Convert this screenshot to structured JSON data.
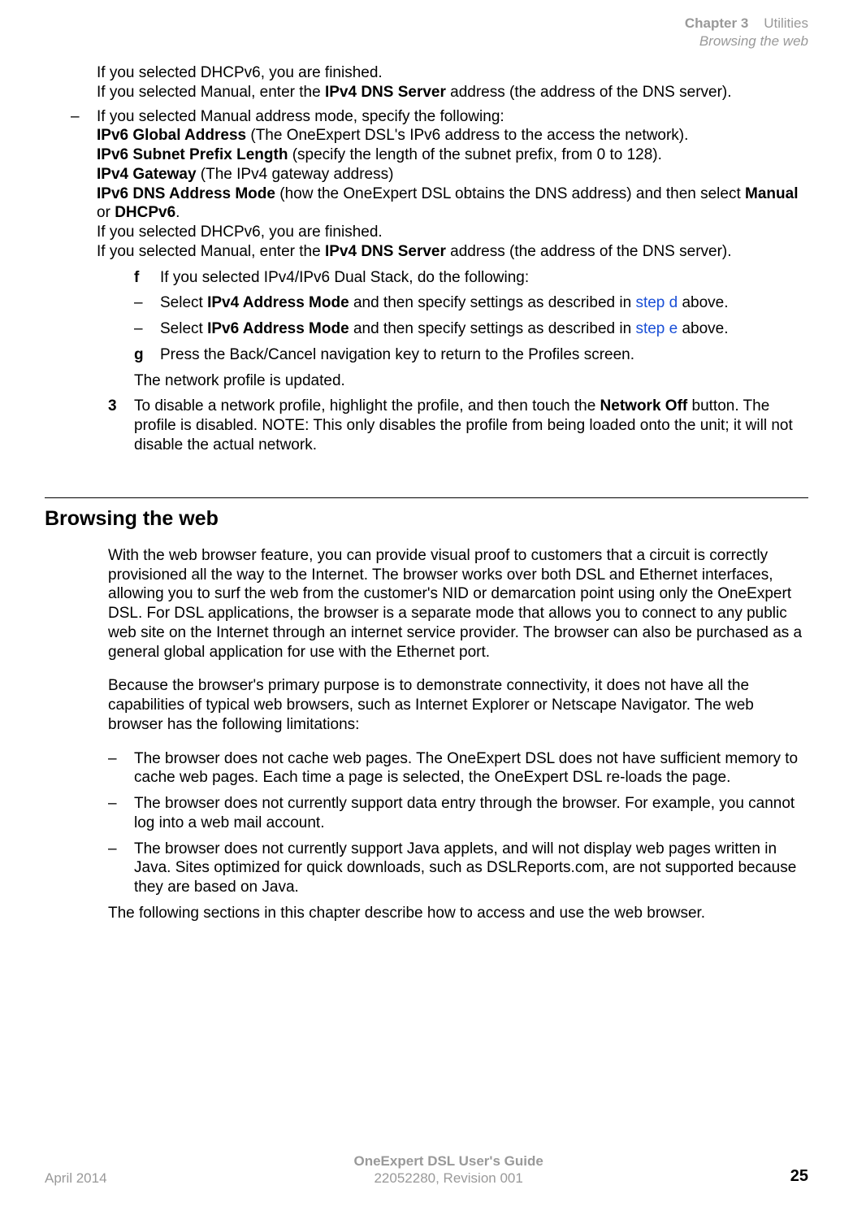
{
  "header": {
    "chapter_label": "Chapter 3",
    "chapter_title": "Utilities",
    "subtitle": "Browsing the web"
  },
  "content": {
    "p1_line1": "If you selected DHCPv6, you are finished.",
    "p1_line2a": "If you selected Manual, enter the ",
    "p1_bold1": "IPv4 DNS Server",
    "p1_line2b": " address (the address of the DNS server).",
    "dash": "–",
    "m1_intro": "If you selected Manual address mode, specify the following:",
    "m1_b1": "IPv6 Global Address",
    "m1_t1": " (The OneExpert DSL's IPv6 address to the access the network).",
    "m1_b2": "IPv6 Subnet Prefix Length",
    "m1_t2": " (specify the length of the subnet prefix, from 0 to 128).",
    "m1_b3": "IPv4 Gateway",
    "m1_t3": " (The IPv4 gateway address)",
    "m1_b4": "IPv6 DNS Address Mode",
    "m1_t4a": " (how the OneExpert DSL obtains the DNS address) and then select ",
    "m1_b5": "Manual",
    "m1_t4b": " or ",
    "m1_b6": "DHCPv6",
    "m1_t4c": ".",
    "m1_line5": "If you selected DHCPv6, you are finished.",
    "m1_line6a": "If you selected Manual, enter the ",
    "m1_b7": "IPv4 DNS Server",
    "m1_line6b": " address (the address of the DNS server).",
    "step_f": "f",
    "f_text": "If you selected IPv4/IPv6 Dual Stack, do the following:",
    "f_d1a": "Select ",
    "f_d1b": "IPv4 Address Mode",
    "f_d1c": " and then specify settings as described in ",
    "f_d1link": "step d",
    "f_d1d": " above.",
    "f_d2a": "Select ",
    "f_d2b": "IPv6 Address Mode",
    "f_d2c": " and then specify settings as described in ",
    "f_d2link": "step e",
    "f_d2d": " above.",
    "step_g": "g",
    "g_text": "Press the Back/Cancel navigation key to return to the Profiles screen.",
    "updated": "The network profile is updated.",
    "step_3": "3",
    "s3_a": "To disable a network profile, highlight the profile, and then touch the ",
    "s3_b": "Network Off",
    "s3_c": " button. The profile is disabled. NOTE: This only disables the profile from being loaded onto the unit; it will not disable the actual network.",
    "heading": "Browsing the web",
    "bw_p1": "With the web browser feature, you can provide visual proof to customers that a circuit is correctly provisioned all the way to the Internet. The browser works over both DSL and Ethernet interfaces, allowing you to surf the web from the customer's NID or demarcation point using only the OneExpert DSL. For DSL applications, the browser is a separate mode that allows you to connect to any public web site on the Internet through an internet service provider. The browser can also be purchased as a general global application for use with the Ethernet port.",
    "bw_p2": "Because the browser's primary purpose is to demonstrate connectivity, it does not have all the capabilities of typical web browsers, such as Internet Explorer or Netscape Navigator. The web browser has the following limitations:",
    "bw_li1": "The browser does not cache web pages. The OneExpert DSL does not have sufficient memory to cache web pages. Each time a page is selected, the OneExpert DSL re-loads the page.",
    "bw_li2": "The browser does not currently support data entry through the browser. For example, you cannot log into a web mail account.",
    "bw_li3": "The browser does not currently support Java applets, and will not display web pages written in Java. Sites optimized for quick downloads, such as DSLReports.com, are not supported because they are based on Java.",
    "bw_p3": "The following sections in this chapter describe how to access and use the web browser."
  },
  "footer": {
    "left": "April 2014",
    "title": "OneExpert DSL User's Guide",
    "rev": "22052280, Revision 001",
    "page": "25"
  }
}
